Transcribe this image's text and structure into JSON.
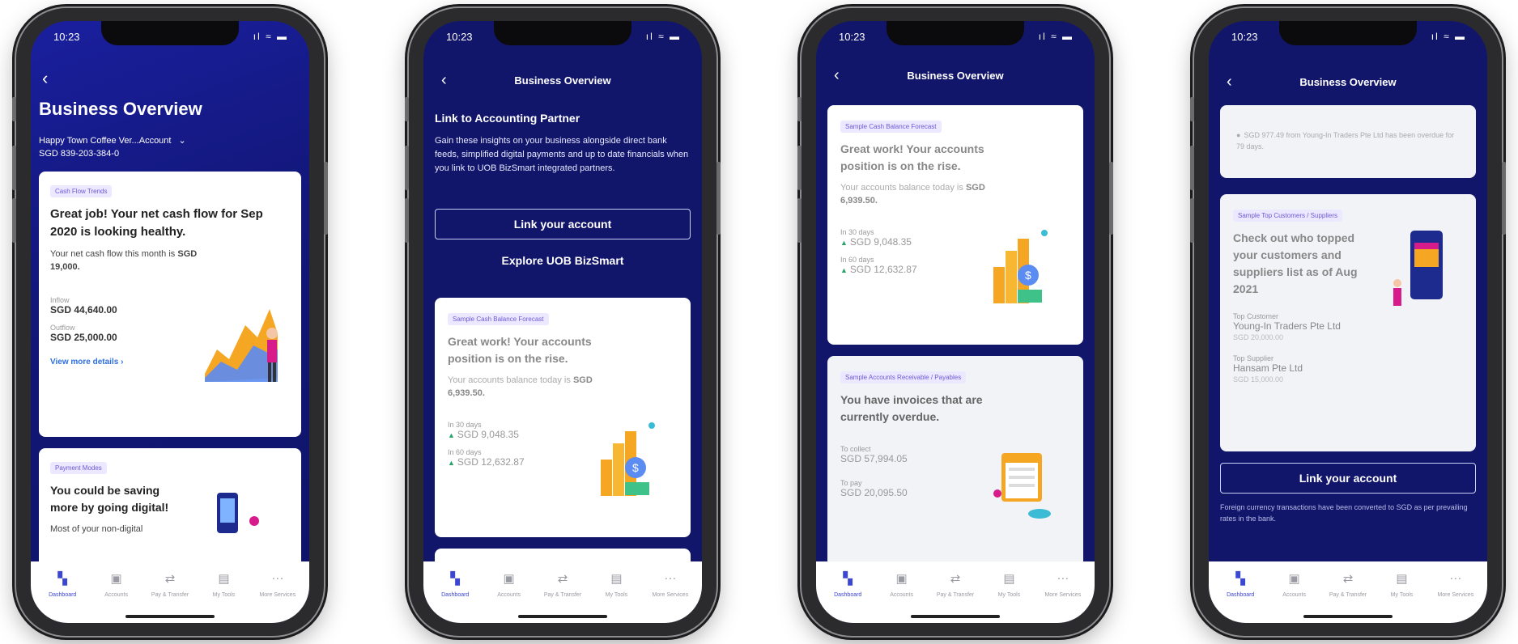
{
  "status": {
    "time": "10:23",
    "icons": "ıl ≈ ▬"
  },
  "tabs": [
    {
      "label": "Dashboard",
      "icon": "dashboard-icon",
      "glyph": "▚"
    },
    {
      "label": "Accounts",
      "icon": "accounts-icon",
      "glyph": "▣"
    },
    {
      "label": "Pay & Transfer",
      "icon": "transfer-icon",
      "glyph": "⇄"
    },
    {
      "label": "My Tools",
      "icon": "tools-icon",
      "glyph": "▤"
    },
    {
      "label": "More Services",
      "icon": "more-icon",
      "glyph": "···"
    }
  ],
  "nav": {
    "back_glyph": "‹",
    "title": "Business Overview"
  },
  "screen1": {
    "title": "Business Overview",
    "account_name": "Happy Town Coffee Ver...Account",
    "account_number": "SGD    839-203-384-0",
    "cash_flow": {
      "tag": "Cash Flow Trends",
      "headline": "Great job! Your net cash flow for Sep 2020 is looking healthy.",
      "body": "Your net cash flow this month is",
      "body_value": "SGD 19,000.",
      "inflow_label": "Inflow",
      "inflow_value": "SGD 44,640.00",
      "outflow_label": "Outflow",
      "outflow_value": "SGD 25,000.00",
      "more_link": "View more details  ›"
    },
    "payment": {
      "tag": "Payment Modes",
      "headline": "You could be saving more by going digital!",
      "partial": "Most of your non-digital"
    }
  },
  "screen2": {
    "heading": "Link to Accounting Partner",
    "desc": "Gain these insights on your business alongside direct bank feeds, simplified digital payments and up to date financials when you link to UOB BizSmart integrated partners.",
    "link_btn": "Link your account",
    "explore": "Explore UOB BizSmart",
    "forecast": {
      "tag": "Sample Cash Balance Forecast",
      "headline": "Great work! Your accounts position is on the rise.",
      "body": "Your accounts balance today is",
      "body_value": "SGD 6,939.50.",
      "d30_label": "In 30 days",
      "d30_value": "SGD 9,048.35",
      "d60_label": "In 60 days",
      "d60_value": "SGD 12,632.87"
    }
  },
  "screen3": {
    "forecast": {
      "tag": "Sample Cash Balance Forecast",
      "headline": "Great work! Your accounts position is on the rise.",
      "body": "Your accounts balance today is",
      "body_value": "SGD 6,939.50.",
      "d30_label": "In 30 days",
      "d30_value": "SGD 9,048.35",
      "d60_label": "In 60 days",
      "d60_value": "SGD 12,632.87"
    },
    "invoices": {
      "tag": "Sample Accounts Receivable / Payables",
      "headline": "You have invoices that are currently overdue.",
      "collect_label": "To collect",
      "collect_value": "SGD 57,994.05",
      "pay_label": "To pay",
      "pay_value": "SGD 20,095.50"
    }
  },
  "screen4": {
    "notice": "SGD 977.49 from Young-In Traders Pte Ltd has been overdue for 79 days.",
    "top": {
      "tag": "Sample Top Customers / Suppliers",
      "headline": "Check out who topped your customers and suppliers list as of Aug 2021",
      "cust_label": "Top Customer",
      "cust_name": "Young-In Traders Pte Ltd",
      "cust_value": "SGD 20,000.00",
      "supp_label": "Top Supplier",
      "supp_name": "Hansam Pte Ltd",
      "supp_value": "SGD 15,000.00"
    },
    "link_btn": "Link your account",
    "footnote": "Foreign currency transactions have been converted to SGD as per prevailing rates in the bank."
  },
  "colors": {
    "navy": "#12166b",
    "accent": "#3b46d1",
    "tag_bg": "#ece8ff",
    "up": "#2aa36a"
  }
}
